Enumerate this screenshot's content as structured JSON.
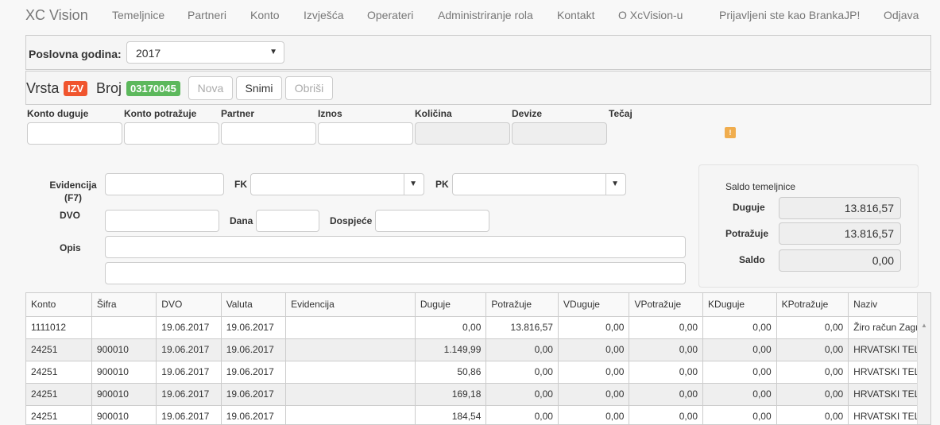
{
  "navbar": {
    "brand": "XC Vision",
    "items": [
      "Temeljnice",
      "Partneri",
      "Konto",
      "Izvješća",
      "Operateri",
      "Administriranje rola",
      "Kontakt",
      "O XcVision-u"
    ],
    "user_text": "Prijavljeni ste kao BrankaJP!",
    "logout": "Odjava"
  },
  "year": {
    "label": "Poslovna godina:",
    "value": "2017"
  },
  "doc": {
    "vrsta_label": "Vrsta",
    "vrsta_badge": "IZV",
    "broj_label": "Broj",
    "broj_badge": "03170045",
    "btn_nova": "Nova",
    "btn_snimi": "Snimi",
    "btn_obrisi": "Obriši",
    "badge_colors": {
      "vrsta": "#f0552e",
      "broj": "#5cb85c"
    }
  },
  "entry": {
    "labels": [
      "Konto duguje",
      "Konto potražuje",
      "Partner",
      "Iznos",
      "Količina",
      "Devize",
      "Tečaj"
    ],
    "warning_icon": "!"
  },
  "details": {
    "evidencija_label": "Evidencija (F7)",
    "fk_label": "FK",
    "pk_label": "PK",
    "dvo_label": "DVO",
    "dana_label": "Dana",
    "dospjece_label": "Dospjeće",
    "opis_label": "Opis"
  },
  "saldo": {
    "title": "Saldo temeljnice",
    "duguje_label": "Duguje",
    "duguje_value": "13.816,57",
    "potrazuje_label": "Potražuje",
    "potrazuje_value": "13.816,57",
    "saldo_label": "Saldo",
    "saldo_value": "0,00"
  },
  "table": {
    "columns": [
      "Konto",
      "Šifra",
      "DVO",
      "Valuta",
      "Evidencija",
      "Duguje",
      "Potražuje",
      "VDuguje",
      "VPotražuje",
      "KDuguje",
      "KPotražuje",
      "Naziv"
    ],
    "rows": [
      [
        "1111012",
        "",
        "19.06.2017",
        "19.06.2017",
        "",
        "0,00",
        "13.816,57",
        "0,00",
        "0,00",
        "0,00",
        "0,00",
        "Žiro račun Zagreb"
      ],
      [
        "24251",
        "900010",
        "19.06.2017",
        "19.06.2017",
        "",
        "1.149,99",
        "0,00",
        "0,00",
        "0,00",
        "0,00",
        "0,00",
        "HRVATSKI TELEKOM"
      ],
      [
        "24251",
        "900010",
        "19.06.2017",
        "19.06.2017",
        "",
        "50,86",
        "0,00",
        "0,00",
        "0,00",
        "0,00",
        "0,00",
        "HRVATSKI TELEKOM"
      ],
      [
        "24251",
        "900010",
        "19.06.2017",
        "19.06.2017",
        "",
        "169,18",
        "0,00",
        "0,00",
        "0,00",
        "0,00",
        "0,00",
        "HRVATSKI TELEKOM"
      ],
      [
        "24251",
        "900010",
        "19.06.2017",
        "19.06.2017",
        "",
        "184,54",
        "0,00",
        "0,00",
        "0,00",
        "0,00",
        "0,00",
        "HRVATSKI TELEKOM"
      ]
    ]
  }
}
